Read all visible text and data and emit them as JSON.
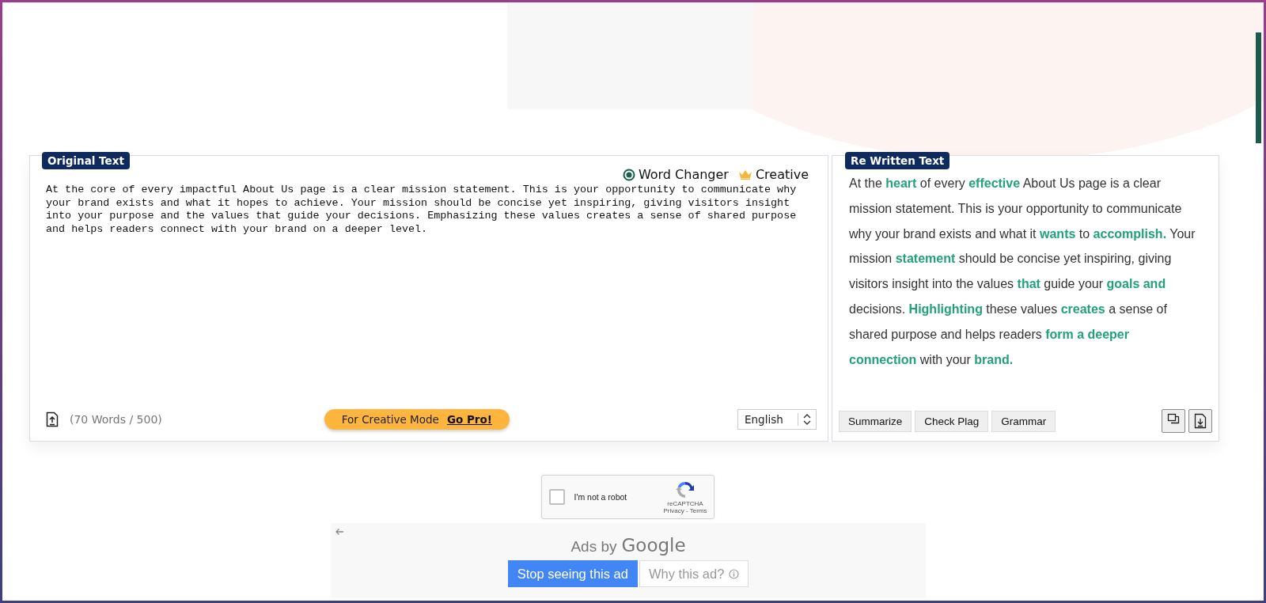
{
  "source": {
    "label": "Original Text",
    "modes": [
      {
        "label": "Word Changer",
        "kind": "radio",
        "selected": true
      },
      {
        "label": "Creative",
        "kind": "pro",
        "selected": false
      }
    ],
    "text": "At the core of every impactful About Us page is a clear mission statement. This is your opportunity to communicate why your brand exists and what it hopes to achieve. Your mission should be concise yet inspiring, giving visitors insight into your purpose and the values that guide your decisions. Emphasizing these values creates a sense of shared purpose and helps readers connect with your brand on a deeper level.",
    "word_count": "(70 Words / 500)",
    "promo": {
      "text": "For Creative Mode",
      "link": "Go Pro!"
    },
    "language": "English"
  },
  "result": {
    "label": "Re Written Text",
    "text": "At the **heart** of every **effective** About Us page is a clear mission statement. This is your opportunity to communicate why your brand exists and what it **wants** to **accomplish.** Your mission **statement** should be concise yet inspiring, giving visitors insight into the values **that** guide your **goals and** decisions. **Highlighting** these values **creates** a sense of shared purpose and helps readers **form a deeper connection** with your **brand.**",
    "actions": [
      "Summarize",
      "Check Plag",
      "Grammar"
    ]
  },
  "captcha": {
    "label": "I'm not a robot",
    "checked": false,
    "brand": "reCAPTCHA",
    "links": "Privacy - Terms"
  },
  "ad": {
    "ads_by": "Ads by",
    "network": "Google",
    "buttons": [
      {
        "label": "Stop seeing this ad",
        "kind": "primary"
      },
      {
        "label": "Why this ad?",
        "kind": "info"
      }
    ]
  }
}
